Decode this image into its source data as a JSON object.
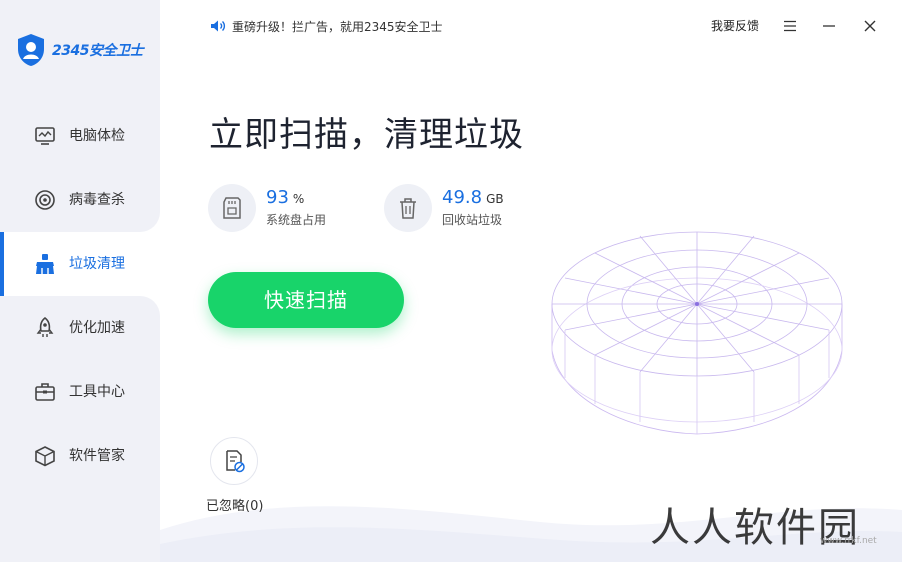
{
  "app": {
    "logo_text": "2345安全卫士"
  },
  "header": {
    "notice": "重磅升级！拦广告，就用2345安全卫士",
    "feedback": "我要反馈"
  },
  "sidebar": {
    "items": [
      {
        "label": "电脑体检",
        "icon": "monitor-icon"
      },
      {
        "label": "病毒查杀",
        "icon": "target-icon"
      },
      {
        "label": "垃圾清理",
        "icon": "broom-icon",
        "active": true
      },
      {
        "label": "优化加速",
        "icon": "rocket-icon"
      },
      {
        "label": "工具中心",
        "icon": "toolbox-icon"
      },
      {
        "label": "软件管家",
        "icon": "box-icon"
      }
    ]
  },
  "main": {
    "headline": "立即扫描，清理垃圾",
    "stats": [
      {
        "value": "93",
        "unit": "%",
        "label": "系统盘占用",
        "icon": "sd-card-icon"
      },
      {
        "value": "49.8",
        "unit": "GB",
        "label": "回收站垃圾",
        "icon": "trash-icon"
      }
    ],
    "scan_button": "快速扫描",
    "ignored_label": "已忽略(0)"
  },
  "watermark": {
    "text": "人人软件园",
    "url": "www.rrkf.net"
  },
  "colors": {
    "accent": "#1a6fe0",
    "scan_button": "#18d46a",
    "sidebar_bg": "#f0f1f7"
  }
}
